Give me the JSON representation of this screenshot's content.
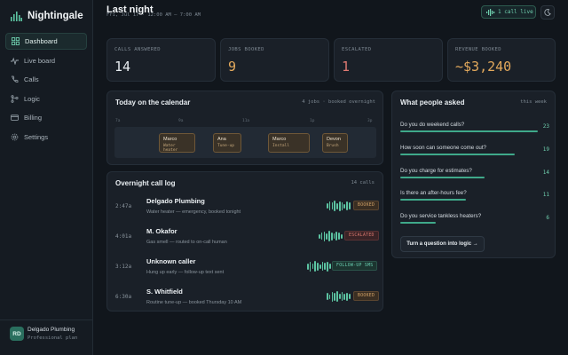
{
  "brand": {
    "name": "Nightingale"
  },
  "nav": [
    {
      "label": "Dashboard",
      "icon": "grid-icon"
    },
    {
      "label": "Live board",
      "icon": "pulse-icon"
    },
    {
      "label": "Calls",
      "icon": "phone-icon"
    },
    {
      "label": "Logic",
      "icon": "branch-icon"
    },
    {
      "label": "Billing",
      "icon": "card-icon"
    },
    {
      "label": "Settings",
      "icon": "gear-icon"
    }
  ],
  "account": {
    "initials": "RD",
    "name": "Delgado Plumbing",
    "plan": "Professional plan"
  },
  "header": {
    "title": "Last night",
    "subtitle": "Fri, Jul 17 · 12:00 AM – 7:00 AM",
    "live_label": "1 call live"
  },
  "stats": [
    {
      "label": "CALLS ANSWERED",
      "value": "14",
      "color": "#e6ebef"
    },
    {
      "label": "JOBS BOOKED",
      "value": "9",
      "color": "#e3a95c"
    },
    {
      "label": "ESCALATED",
      "value": "1",
      "color": "#e07a72"
    },
    {
      "label": "REVENUE BOOKED",
      "value": "~$3,240",
      "color": "#e3a95c"
    }
  ],
  "calendar": {
    "title": "Today on the calendar",
    "meta": "4 jobs · booked overnight",
    "ticks": [
      "7a",
      "9a",
      "11a",
      "1p",
      "3p"
    ],
    "events": [
      {
        "name": "Marco",
        "type": "Water heater"
      },
      {
        "name": "Ana",
        "type": "Tune-up"
      },
      {
        "name": "Marco",
        "type": "Install"
      },
      {
        "name": "Devon",
        "type": "Brush"
      }
    ]
  },
  "calllog": {
    "title": "Overnight call log",
    "meta": "14 calls",
    "calls": [
      {
        "time": "2:47a",
        "name": "Delgado Plumbing",
        "desc": "Water heater — emergency, booked tonight",
        "badge": "BOOKED"
      },
      {
        "time": "4:01a",
        "name": "M. Okafor",
        "desc": "Gas smell — routed to on-call human",
        "badge": "ESCALATED"
      },
      {
        "time": "3:12a",
        "name": "Unknown caller",
        "desc": "Hung up early — follow-up text sent",
        "badge": "FOLLOW-UP SMS"
      },
      {
        "time": "6:30a",
        "name": "S. Whitfield",
        "desc": "Routine tune-up — booked Thursday 10 AM",
        "badge": "BOOKED"
      }
    ]
  },
  "questions": {
    "title": "What people asked",
    "meta": "this week",
    "items": [
      {
        "text": "Do you do weekend calls?",
        "count": "23",
        "share": 1.0
      },
      {
        "text": "How soon can someone come out?",
        "count": "19",
        "share": 0.83
      },
      {
        "text": "Do you charge for estimates?",
        "count": "14",
        "share": 0.61
      },
      {
        "text": "Is there an after-hours fee?",
        "count": "11",
        "share": 0.48
      },
      {
        "text": "Do you service tankless heaters?",
        "count": "6",
        "share": 0.26
      }
    ],
    "cta": "Turn a question into logic →"
  }
}
